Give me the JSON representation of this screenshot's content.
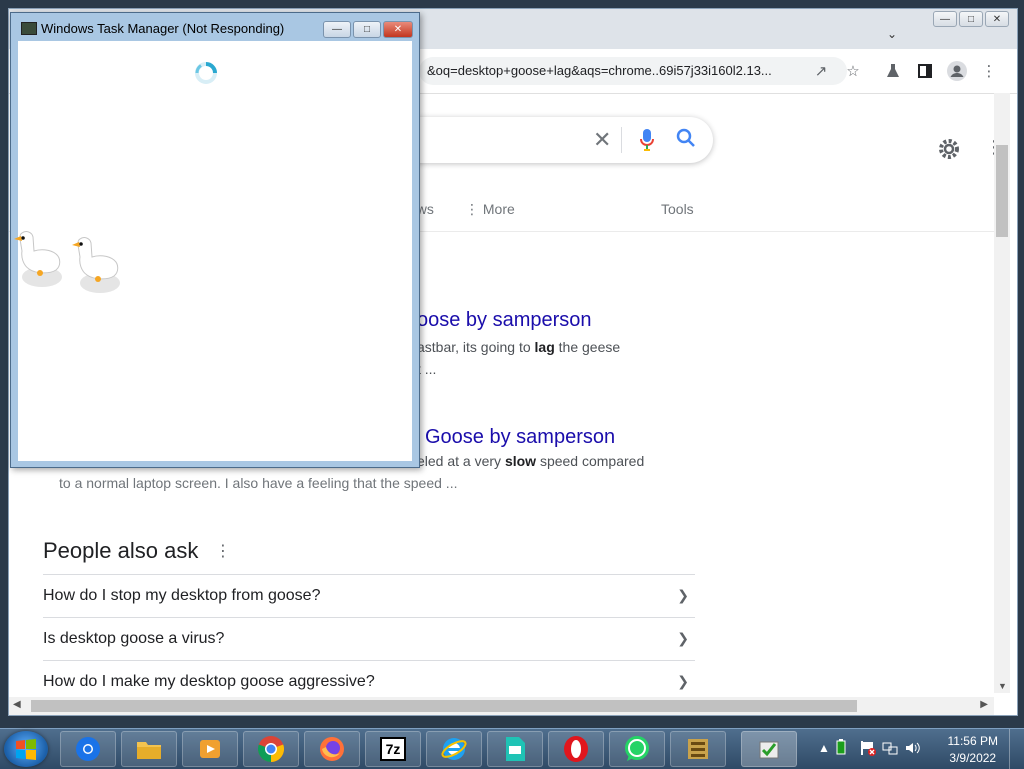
{
  "chrome": {
    "address_text": "&oq=desktop+goose+lag&aqs=chrome..69i57j33i160l2.13...",
    "nav": {
      "news": "ews",
      "more": "More",
      "tools": "Tools"
    },
    "results": [
      {
        "title": "oose by samperson",
        "snippet_pre": "astbar, its going to ",
        "snippet_bold": "lag",
        "snippet_post": " the geese",
        "snippet2": "t ..."
      },
      {
        "title": "Goose by samperson",
        "snippet_pre": "eled at a very ",
        "snippet_bold": "slow",
        "snippet_post": " speed compared",
        "snippet2": "to a normal laptop screen. I also have a feeling that the speed ..."
      }
    ],
    "paa": {
      "title": "People also ask",
      "questions": [
        "How do I stop my desktop from goose?",
        "Is desktop goose a virus?",
        "How do I make my desktop goose aggressive?"
      ]
    },
    "colors": {
      "link": "#1a0dab",
      "mic_blue": "#4285f4",
      "mic_red": "#ea4335"
    }
  },
  "task_manager": {
    "title": "Windows Task Manager (Not Responding)",
    "buttons": {
      "minimize": "▭",
      "maximize": "▢",
      "close": "✕"
    }
  },
  "taskbar": {
    "apps": [
      "Chrome Canary",
      "File Explorer",
      "Media Player",
      "Chrome",
      "Firefox",
      "7-Zip",
      "Internet Explorer",
      "Image Viewer",
      "Opera",
      "WhatsApp",
      "Archive Tool",
      "Task Scheduler"
    ],
    "sevenzip_label": "7z",
    "clock_time": "11:56 PM",
    "clock_date": "3/9/2022"
  }
}
